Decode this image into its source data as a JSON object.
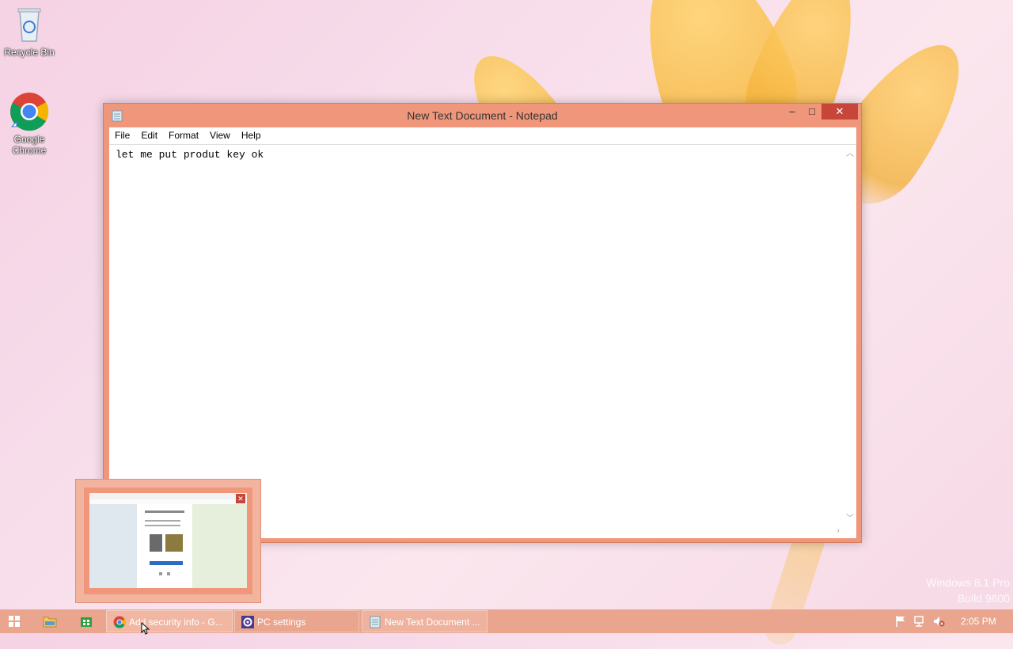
{
  "desktop": {
    "icons": [
      {
        "label": "Recycle Bin"
      },
      {
        "label": "Google\nChrome"
      }
    ],
    "watermark": {
      "line1": "Windows 8.1 Pro",
      "line2": "Build 9600"
    }
  },
  "notepad": {
    "title": "New Text Document - Notepad",
    "menu": [
      "File",
      "Edit",
      "Format",
      "View",
      "Help"
    ],
    "content": "let me put produt key ok",
    "controls": {
      "minimize": "–",
      "maximize": "□",
      "close": "✕"
    }
  },
  "taskbar": {
    "tasks": [
      {
        "label": "Add security info - G...",
        "icon": "chrome-icon"
      },
      {
        "label": "PC settings",
        "icon": "gear-icon"
      },
      {
        "label": "New Text Document ...",
        "icon": "notepad-icon"
      }
    ],
    "clock": "2:05 PM"
  },
  "thumbnail": {
    "close": "✕"
  },
  "colors": {
    "window_frame": "#f0977b",
    "taskbar": "#e9a58d",
    "close_red": "#c7463a"
  }
}
